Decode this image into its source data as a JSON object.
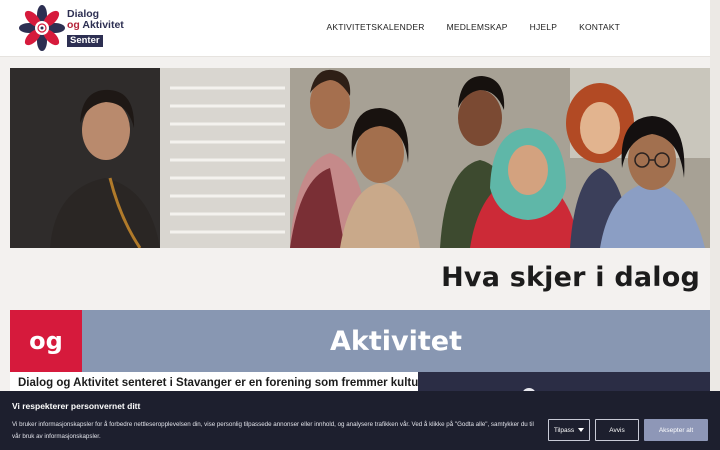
{
  "header": {
    "logo": {
      "line1": "Dialog",
      "line2_og": "og",
      "line2_rest": "Aktivitet",
      "badge": "Senter"
    },
    "nav": [
      {
        "label": "AKTIVITETSKALENDER"
      },
      {
        "label": "MEDLEMSKAP"
      },
      {
        "label": "HJELP"
      },
      {
        "label": "KONTAKT"
      }
    ]
  },
  "hero": {
    "image": "group-of-smiling-people-photo"
  },
  "section": {
    "title": "Hva skjer i dalog"
  },
  "band": {
    "og": "og",
    "title": "Aktivitet"
  },
  "intro": {
    "text": "Dialog og Aktivitet senteret i Stavanger er en forening som fremmer kulturell"
  },
  "cookie": {
    "title": "Vi respekterer personvernet ditt",
    "text": "Vi bruker informasjonskapsler for å forbedre nettleseropplevelsen din, vise personlig tilpassede annonser eller innhold, og analysere trafikken vår. Ved å klikke på \"Godta alle\", samtykker du til vår bruk av informasjonskapsler.",
    "buttons": {
      "customize": "Tilpass",
      "reject": "Avvis",
      "accept": "Aksepter alt"
    }
  },
  "colors": {
    "brand_red": "#d61a3c",
    "brand_navy": "#2d2f52",
    "band_blue": "#8897b2",
    "cookie_bg": "#1d1f2e"
  }
}
